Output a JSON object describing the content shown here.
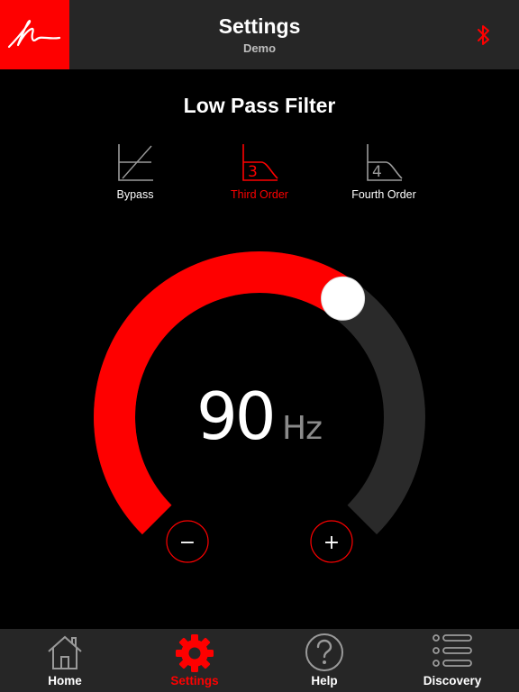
{
  "header": {
    "title": "Settings",
    "subtitle": "Demo",
    "logo_icon": "signature-logo",
    "bluetooth_icon": "bluetooth-icon"
  },
  "section": {
    "title": "Low Pass Filter"
  },
  "filters": [
    {
      "label": "Bypass",
      "icon": "bypass-filter-icon",
      "selected": false
    },
    {
      "label": "Third Order",
      "icon_text": "3",
      "icon": "third-order-filter-icon",
      "selected": true
    },
    {
      "label": "Fourth Order",
      "icon_text": "4",
      "icon": "fourth-order-filter-icon",
      "selected": false
    }
  ],
  "dial": {
    "value": "90",
    "unit": "Hz",
    "level_fraction": 0.63,
    "minus_label": "−",
    "plus_label": "+"
  },
  "tabs": [
    {
      "label": "Home",
      "icon": "home-icon",
      "active": false
    },
    {
      "label": "Settings",
      "icon": "gear-icon",
      "active": true
    },
    {
      "label": "Help",
      "icon": "help-icon",
      "active": false
    },
    {
      "label": "Discovery",
      "icon": "list-icon",
      "active": false
    }
  ],
  "colors": {
    "accent": "#fe0000",
    "bar": "#262626",
    "track": "#2a2a2a",
    "inactive": "#ffffff",
    "icon_inactive": "#9a9a9a"
  }
}
